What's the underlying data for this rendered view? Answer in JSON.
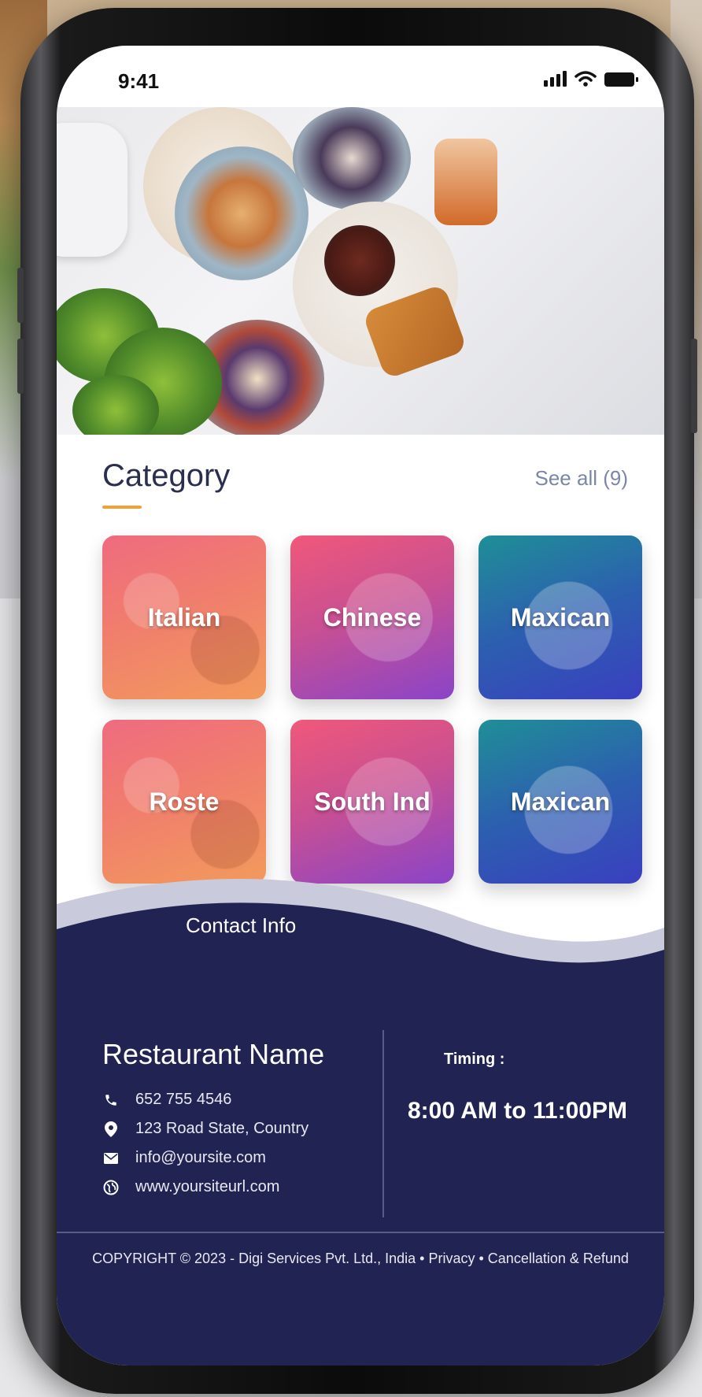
{
  "status_bar": {
    "time": "9:41"
  },
  "category": {
    "title": "Category",
    "see_all": "See all (9)",
    "items": [
      {
        "label": "Italian"
      },
      {
        "label": "Chinese"
      },
      {
        "label": "Maxican"
      },
      {
        "label": "Roste"
      },
      {
        "label": "South Ind"
      },
      {
        "label": "Maxican"
      }
    ]
  },
  "contact": {
    "section_title": "Contact Info",
    "restaurant_name": "Restaurant Name",
    "phone": "652 755 4546",
    "address": "123 Road State, Country",
    "email": "info@yoursite.com",
    "website": "www.yoursiteurl.com",
    "timing_label": "Timing :",
    "timing_value": "8:00 AM to 11:00PM"
  },
  "footer": {
    "copyright": "COPYRIGHT © 2023 - Digi Services Pvt. Ltd., India • Privacy  • Cancellation & Refund"
  },
  "icons": {
    "signal": "signal-icon",
    "wifi": "wifi-icon",
    "battery": "battery-icon",
    "phone": "phone-icon",
    "location": "location-pin-icon",
    "email": "mail-icon",
    "website": "globe-icon"
  },
  "colors": {
    "accent": "#f0a23a",
    "footer_bg": "#212352",
    "title_text": "#2b2f4e",
    "see_all_text": "#7b86a8"
  }
}
